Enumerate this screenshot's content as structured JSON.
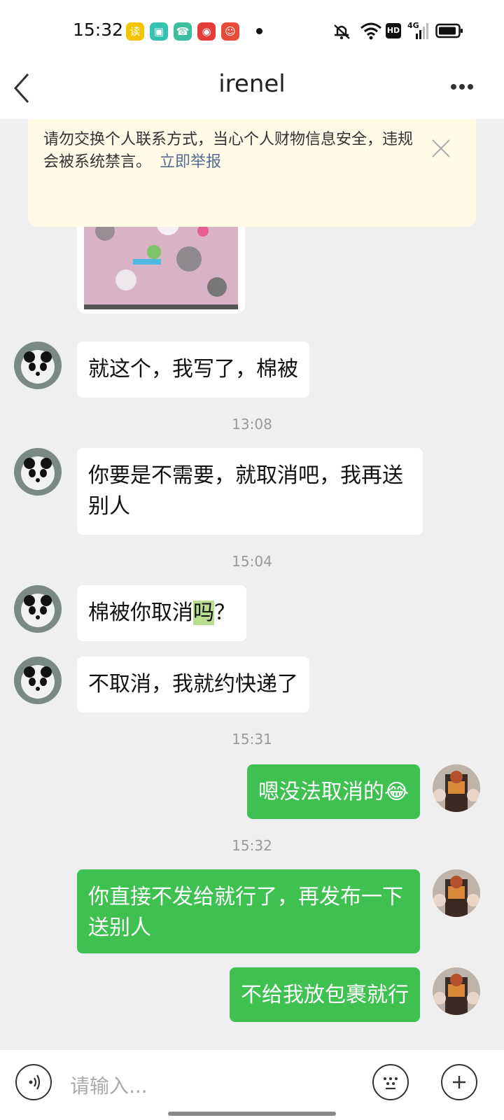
{
  "status_bar": {
    "time": "15:32",
    "app_icons": [
      {
        "name": "app-icon-yellow",
        "color": "#f5c400",
        "glyph": "读"
      },
      {
        "name": "app-icon-teal-square",
        "color": "#33c3b0",
        "glyph": "▣"
      },
      {
        "name": "app-icon-phone",
        "color": "#3bbfa0",
        "glyph": "☎"
      },
      {
        "name": "app-icon-netease-music",
        "color": "#e63b3b",
        "glyph": "◉"
      },
      {
        "name": "app-icon-red-mascot",
        "color": "#e84a3a",
        "glyph": "☺"
      }
    ],
    "hd_label": "HD",
    "network_label": "4G"
  },
  "nav": {
    "title": "irenel"
  },
  "notice": {
    "text": "请勿交换个人联系方式，当心个人财物信息安全，违规会被系统禁言。",
    "link": "立即举报"
  },
  "messages": [
    {
      "type": "in",
      "text": "就这个，我写了，棉被"
    },
    {
      "type": "time",
      "text": "13:08"
    },
    {
      "type": "in",
      "text": "你要是不需要，就取消吧，我再送别人"
    },
    {
      "type": "time",
      "text": "15:04"
    },
    {
      "type": "in",
      "text_before": "棉被你取消",
      "text_highlight": "吗",
      "text_after": "？"
    },
    {
      "type": "in",
      "text": "不取消，我就约快递了"
    },
    {
      "type": "time",
      "text": "15:31"
    },
    {
      "type": "out",
      "text": "嗯没法取消的",
      "emoji": "😂"
    },
    {
      "type": "time",
      "text": "15:32"
    },
    {
      "type": "out",
      "text": "你直接不发给就行了，再发布一下送别人"
    },
    {
      "type": "out",
      "text": "不给我放包裹就行"
    }
  ],
  "input": {
    "placeholder": "请输入..."
  },
  "colors": {
    "accent_green": "#3fc152",
    "notice_bg": "#fffbe6",
    "link": "#576b95"
  }
}
